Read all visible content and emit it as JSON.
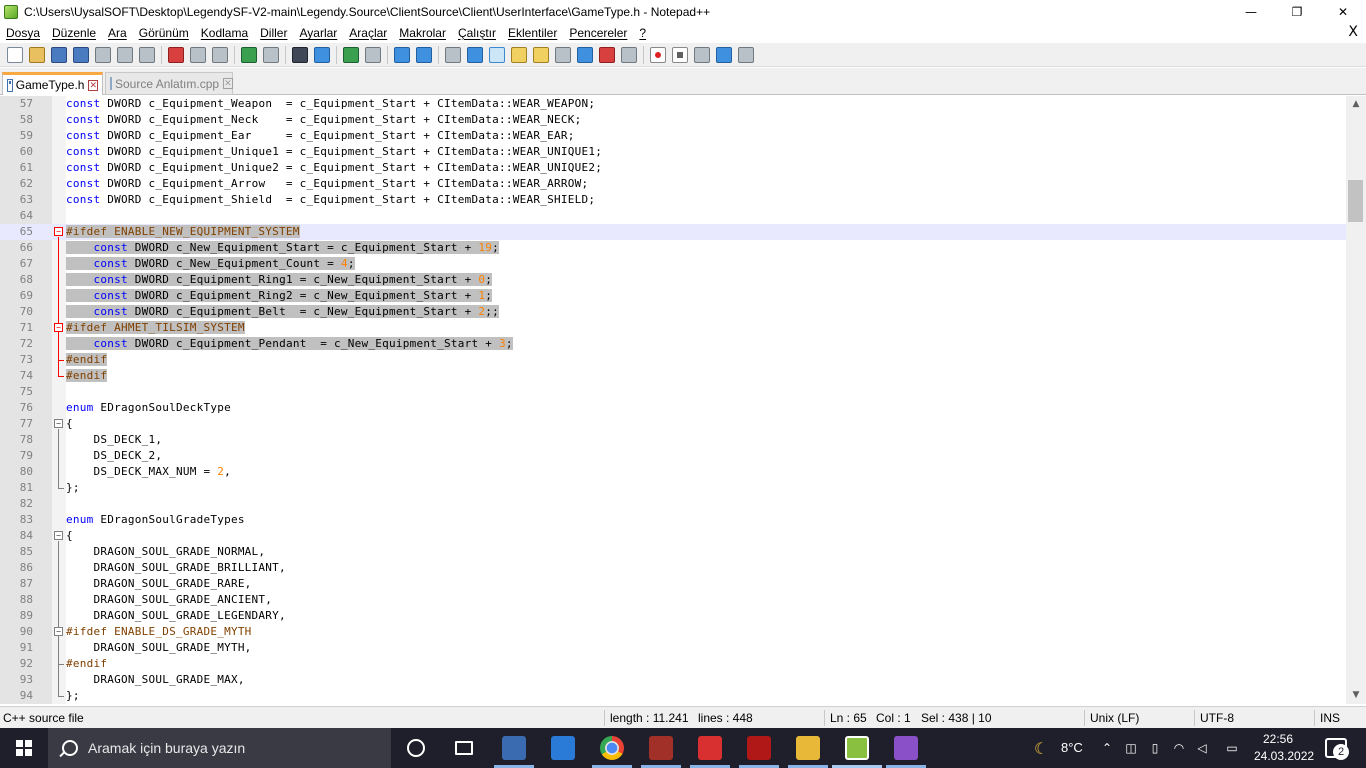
{
  "window": {
    "title": "C:\\Users\\UysalSOFT\\Desktop\\LegendySF-V2-main\\Legendy.Source\\ClientSource\\Client\\UserInterface\\GameType.h - Notepad++",
    "minimize_glyph": "—",
    "restore_glyph": "❐",
    "close_glyph": "✕"
  },
  "menu": {
    "items": [
      "Dosya",
      "Düzenle",
      "Ara",
      "Görünüm",
      "Kodlama",
      "Diller",
      "Ayarlar",
      "Araçlar",
      "Makrolar",
      "Çalıştır",
      "Eklentiler",
      "Pencereler",
      "?"
    ],
    "close_glyph": "X"
  },
  "tabs": [
    {
      "label": "GameType.h",
      "active": true,
      "close_glyph": "✕"
    },
    {
      "label": "Source Anlatım.cpp",
      "active": false,
      "close_glyph": "✕"
    }
  ],
  "editor": {
    "current_line": 65,
    "lines": [
      {
        "n": "57",
        "code": "const DWORD c_Equipment_Weapon  = c_Equipment_Start + CItemData::WEAR_WEAPON;"
      },
      {
        "n": "58",
        "code": "const DWORD c_Equipment_Neck    = c_Equipment_Start + CItemData::WEAR_NECK;"
      },
      {
        "n": "59",
        "code": "const DWORD c_Equipment_Ear     = c_Equipment_Start + CItemData::WEAR_EAR;"
      },
      {
        "n": "60",
        "code": "const DWORD c_Equipment_Unique1 = c_Equipment_Start + CItemData::WEAR_UNIQUE1;"
      },
      {
        "n": "61",
        "code": "const DWORD c_Equipment_Unique2 = c_Equipment_Start + CItemData::WEAR_UNIQUE2;"
      },
      {
        "n": "62",
        "code": "const DWORD c_Equipment_Arrow   = c_Equipment_Start + CItemData::WEAR_ARROW;"
      },
      {
        "n": "63",
        "code": "const DWORD c_Equipment_Shield  = c_Equipment_Start + CItemData::WEAR_SHIELD;"
      },
      {
        "n": "64",
        "code": ""
      },
      {
        "n": "65",
        "code": "#ifdef ENABLE_NEW_EQUIPMENT_SYSTEM"
      },
      {
        "n": "66",
        "code": "    const DWORD c_New_Equipment_Start = c_Equipment_Start + 19;"
      },
      {
        "n": "67",
        "code": "    const DWORD c_New_Equipment_Count = 4;"
      },
      {
        "n": "68",
        "code": "    const DWORD c_Equipment_Ring1 = c_New_Equipment_Start + 0;"
      },
      {
        "n": "69",
        "code": "    const DWORD c_Equipment_Ring2 = c_New_Equipment_Start + 1;"
      },
      {
        "n": "70",
        "code": "    const DWORD c_Equipment_Belt  = c_New_Equipment_Start + 2;;"
      },
      {
        "n": "71",
        "code": "#ifdef AHMET_TILSIM_SYSTEM"
      },
      {
        "n": "72",
        "code": "    const DWORD c_Equipment_Pendant  = c_New_Equipment_Start + 3;"
      },
      {
        "n": "73",
        "code": "#endif"
      },
      {
        "n": "74",
        "code": "#endif"
      },
      {
        "n": "75",
        "code": ""
      },
      {
        "n": "76",
        "code": "enum EDragonSoulDeckType"
      },
      {
        "n": "77",
        "code": "{"
      },
      {
        "n": "78",
        "code": "    DS_DECK_1,"
      },
      {
        "n": "79",
        "code": "    DS_DECK_2,"
      },
      {
        "n": "80",
        "code": "    DS_DECK_MAX_NUM = 2,"
      },
      {
        "n": "81",
        "code": "};"
      },
      {
        "n": "82",
        "code": ""
      },
      {
        "n": "83",
        "code": "enum EDragonSoulGradeTypes"
      },
      {
        "n": "84",
        "code": "{"
      },
      {
        "n": "85",
        "code": "    DRAGON_SOUL_GRADE_NORMAL,"
      },
      {
        "n": "86",
        "code": "    DRAGON_SOUL_GRADE_BRILLIANT,"
      },
      {
        "n": "87",
        "code": "    DRAGON_SOUL_GRADE_RARE,"
      },
      {
        "n": "88",
        "code": "    DRAGON_SOUL_GRADE_ANCIENT,"
      },
      {
        "n": "89",
        "code": "    DRAGON_SOUL_GRADE_LEGENDARY,"
      },
      {
        "n": "90",
        "code": "#ifdef ENABLE_DS_GRADE_MYTH"
      },
      {
        "n": "91",
        "code": "    DRAGON_SOUL_GRADE_MYTH,"
      },
      {
        "n": "92",
        "code": "#endif"
      },
      {
        "n": "93",
        "code": "    DRAGON_SOUL_GRADE_MAX,"
      },
      {
        "n": "94",
        "code": "};"
      }
    ]
  },
  "scrollbar": {
    "up_glyph": "▲",
    "down_glyph": "▼"
  },
  "status": {
    "file_type": "C++ source file",
    "length": "length : 11.241",
    "lines": "lines : 448",
    "ln": "Ln : 65",
    "col": "Col : 1",
    "sel": "Sel : 438 | 10",
    "eol": "Unix (LF)",
    "encoding": "UTF-8",
    "mode": "INS"
  },
  "taskbar": {
    "search_placeholder": "Aramak için buraya yazın",
    "weather": "8°C",
    "time": "22:56",
    "date": "24.03.2022",
    "notifications": "2",
    "moon_glyph": "☾",
    "chevron_glyph": "⌃",
    "wifi_glyph": "◠",
    "volume_glyph": "◁",
    "keyboard_glyph": "▭",
    "battery_glyph": "▯",
    "network_glyph": "◫"
  },
  "colors": {
    "keyword": "#0000ff",
    "number": "#ff8000",
    "preprocessor": "#804000",
    "selection": "#c0c0c0",
    "current_line": "#e8e8ff",
    "taskbar": "#1f1f2b"
  }
}
